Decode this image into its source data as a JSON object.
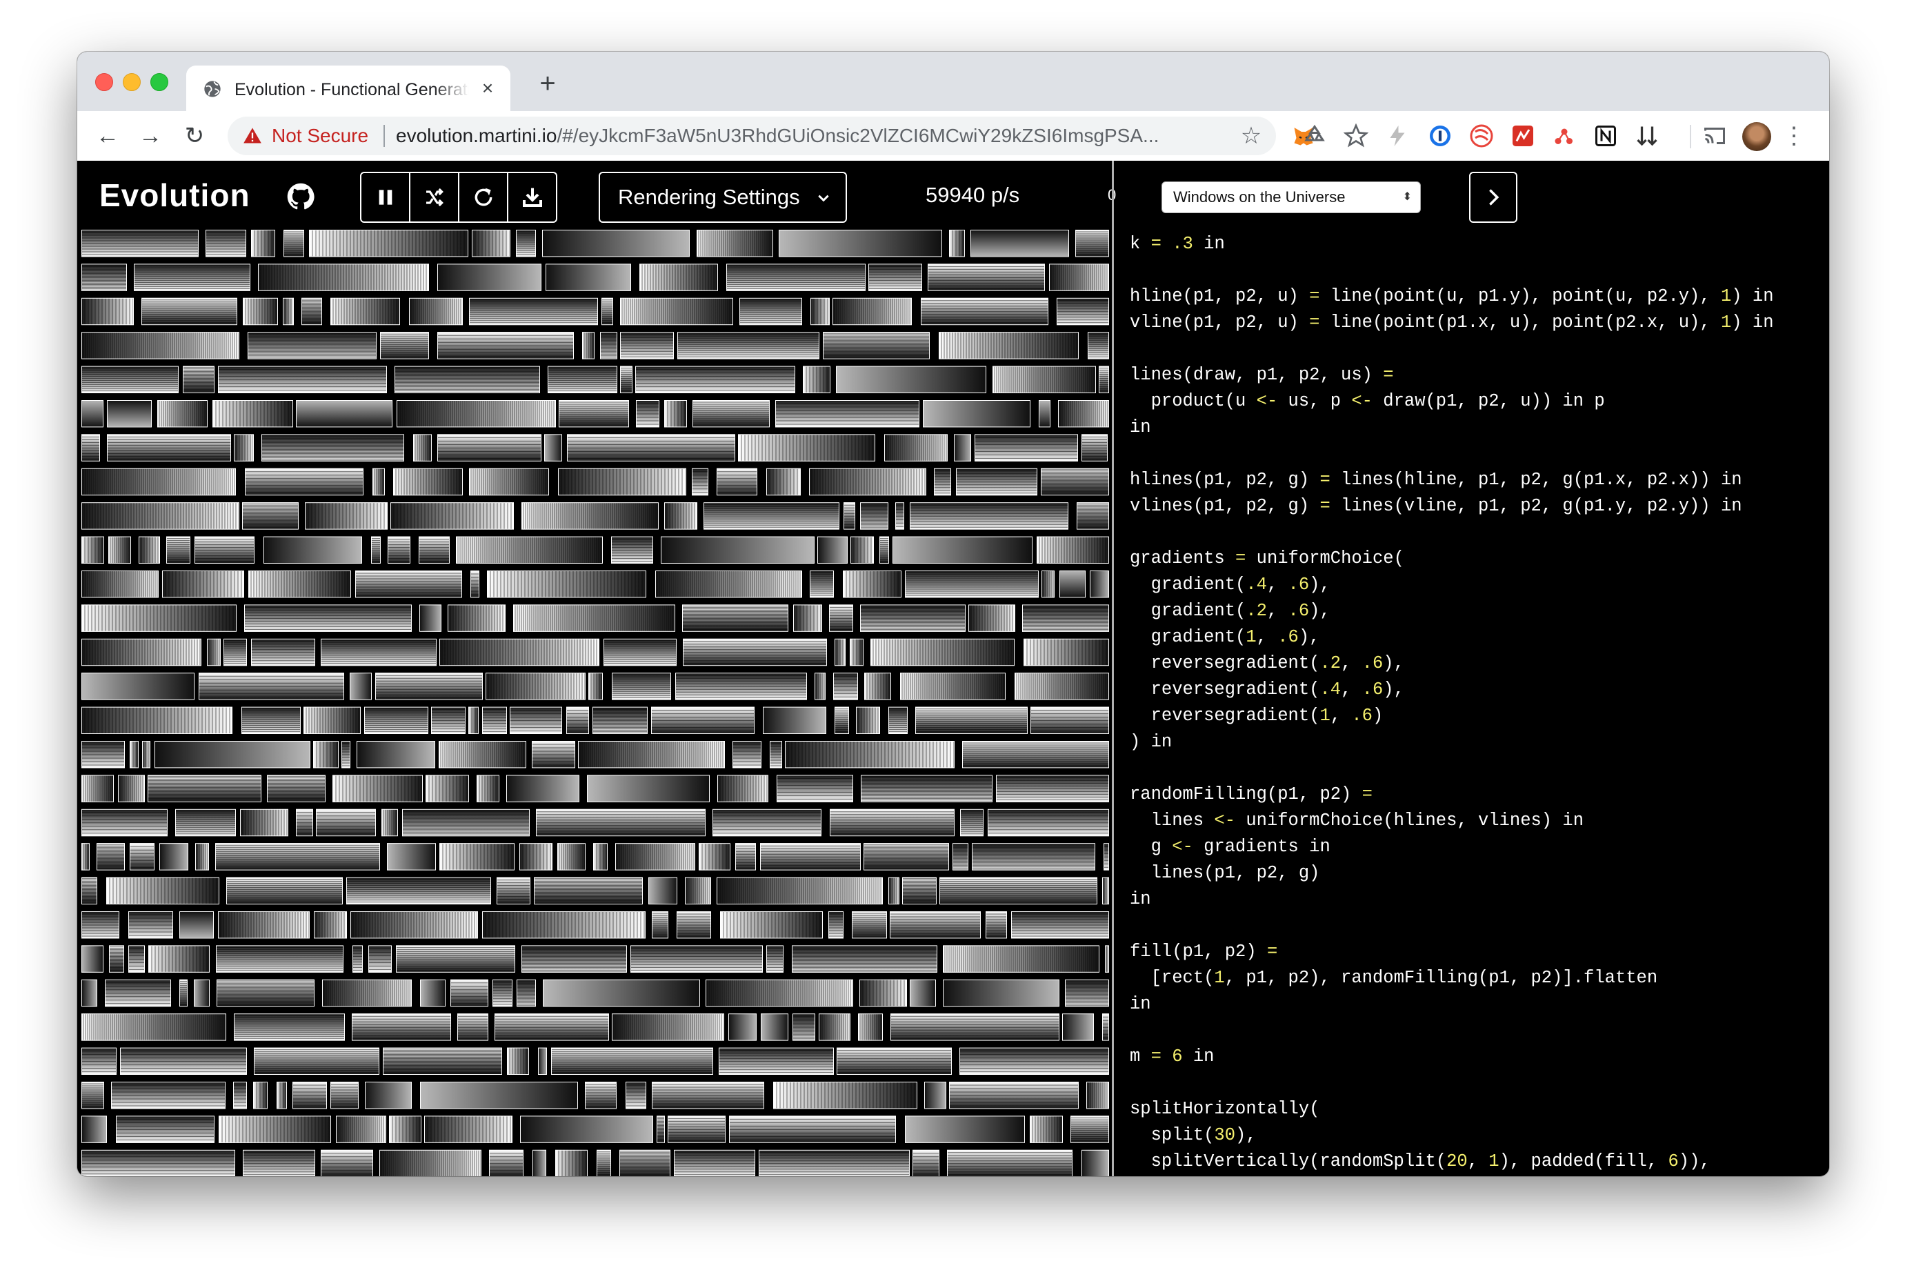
{
  "browser": {
    "tab": {
      "title": "Evolution - Functional Generative Art",
      "close_glyph": "×",
      "icon": "globe-icon"
    },
    "new_tab_glyph": "+",
    "nav": {
      "back": "←",
      "forward": "→",
      "reload": "↻"
    },
    "address": {
      "security_label": "Not Secure",
      "host": "evolution.martini.io",
      "path": "/#/eyJkcmF3aW5nU3RhdGUiOnsic2VlZCI6MCwiY29kZSI6ImsgPSA..."
    },
    "bookmark_glyph": "☆",
    "menu_glyph": "⋮",
    "extensions": [
      "metamask-icon",
      "recycle-icon",
      "star-outline-icon",
      "bolt-icon",
      "onepassword-icon",
      "blocker-icon",
      "red-app-icon",
      "molecule-icon",
      "notion-icon",
      "sort-icon",
      "cast-icon",
      "avatar"
    ]
  },
  "app": {
    "title": "Evolution",
    "controls": [
      "pause-icon",
      "shuffle-icon",
      "reload-icon",
      "download-icon"
    ],
    "rendering_settings_label": "Rendering Settings",
    "rate_label": "59940 p/s",
    "counter": "0",
    "scene": "Windows on the Universe",
    "scene_arrows": "⬍",
    "code_lines": [
      "k = .3 in",
      "",
      "hline(p1, p2, u) = line(point(u, p1.y), point(u, p2.y), 1) in",
      "vline(p1, p2, u) = line(point(p1.x, u), point(p2.x, u), 1) in",
      "",
      "lines(draw, p1, p2, us) =",
      "  product(u <- us, p <- draw(p1, p2, u)) in p",
      "in",
      "",
      "hlines(p1, p2, g) = lines(hline, p1, p2, g(p1.x, p2.x)) in",
      "vlines(p1, p2, g) = lines(vline, p1, p2, g(p1.y, p2.y)) in",
      "",
      "gradients = uniformChoice(",
      "  gradient(.4, .6),",
      "  gradient(.2, .6),",
      "  gradient(1, .6),",
      "  reversegradient(.2, .6),",
      "  reversegradient(.4, .6),",
      "  reversegradient(1, .6)",
      ") in",
      "",
      "randomFilling(p1, p2) =",
      "  lines <- uniformChoice(hlines, vlines) in",
      "  g <- gradients in",
      "  lines(p1, p2, g)",
      "in",
      "",
      "fill(p1, p2) =",
      "  [rect(1, p1, p2), randomFilling(p1, p2)].flatten",
      "in",
      "",
      "m = 6 in",
      "",
      "splitHorizontally(",
      "  split(30),",
      "  splitVertically(randomSplit(20, 1), padded(fill, 6)),"
    ],
    "colors": {
      "number": "#f5f06e",
      "operator": "#f5f06e",
      "text": "#ffffff",
      "background": "#000000",
      "not_secure": "#c5221f"
    }
  }
}
